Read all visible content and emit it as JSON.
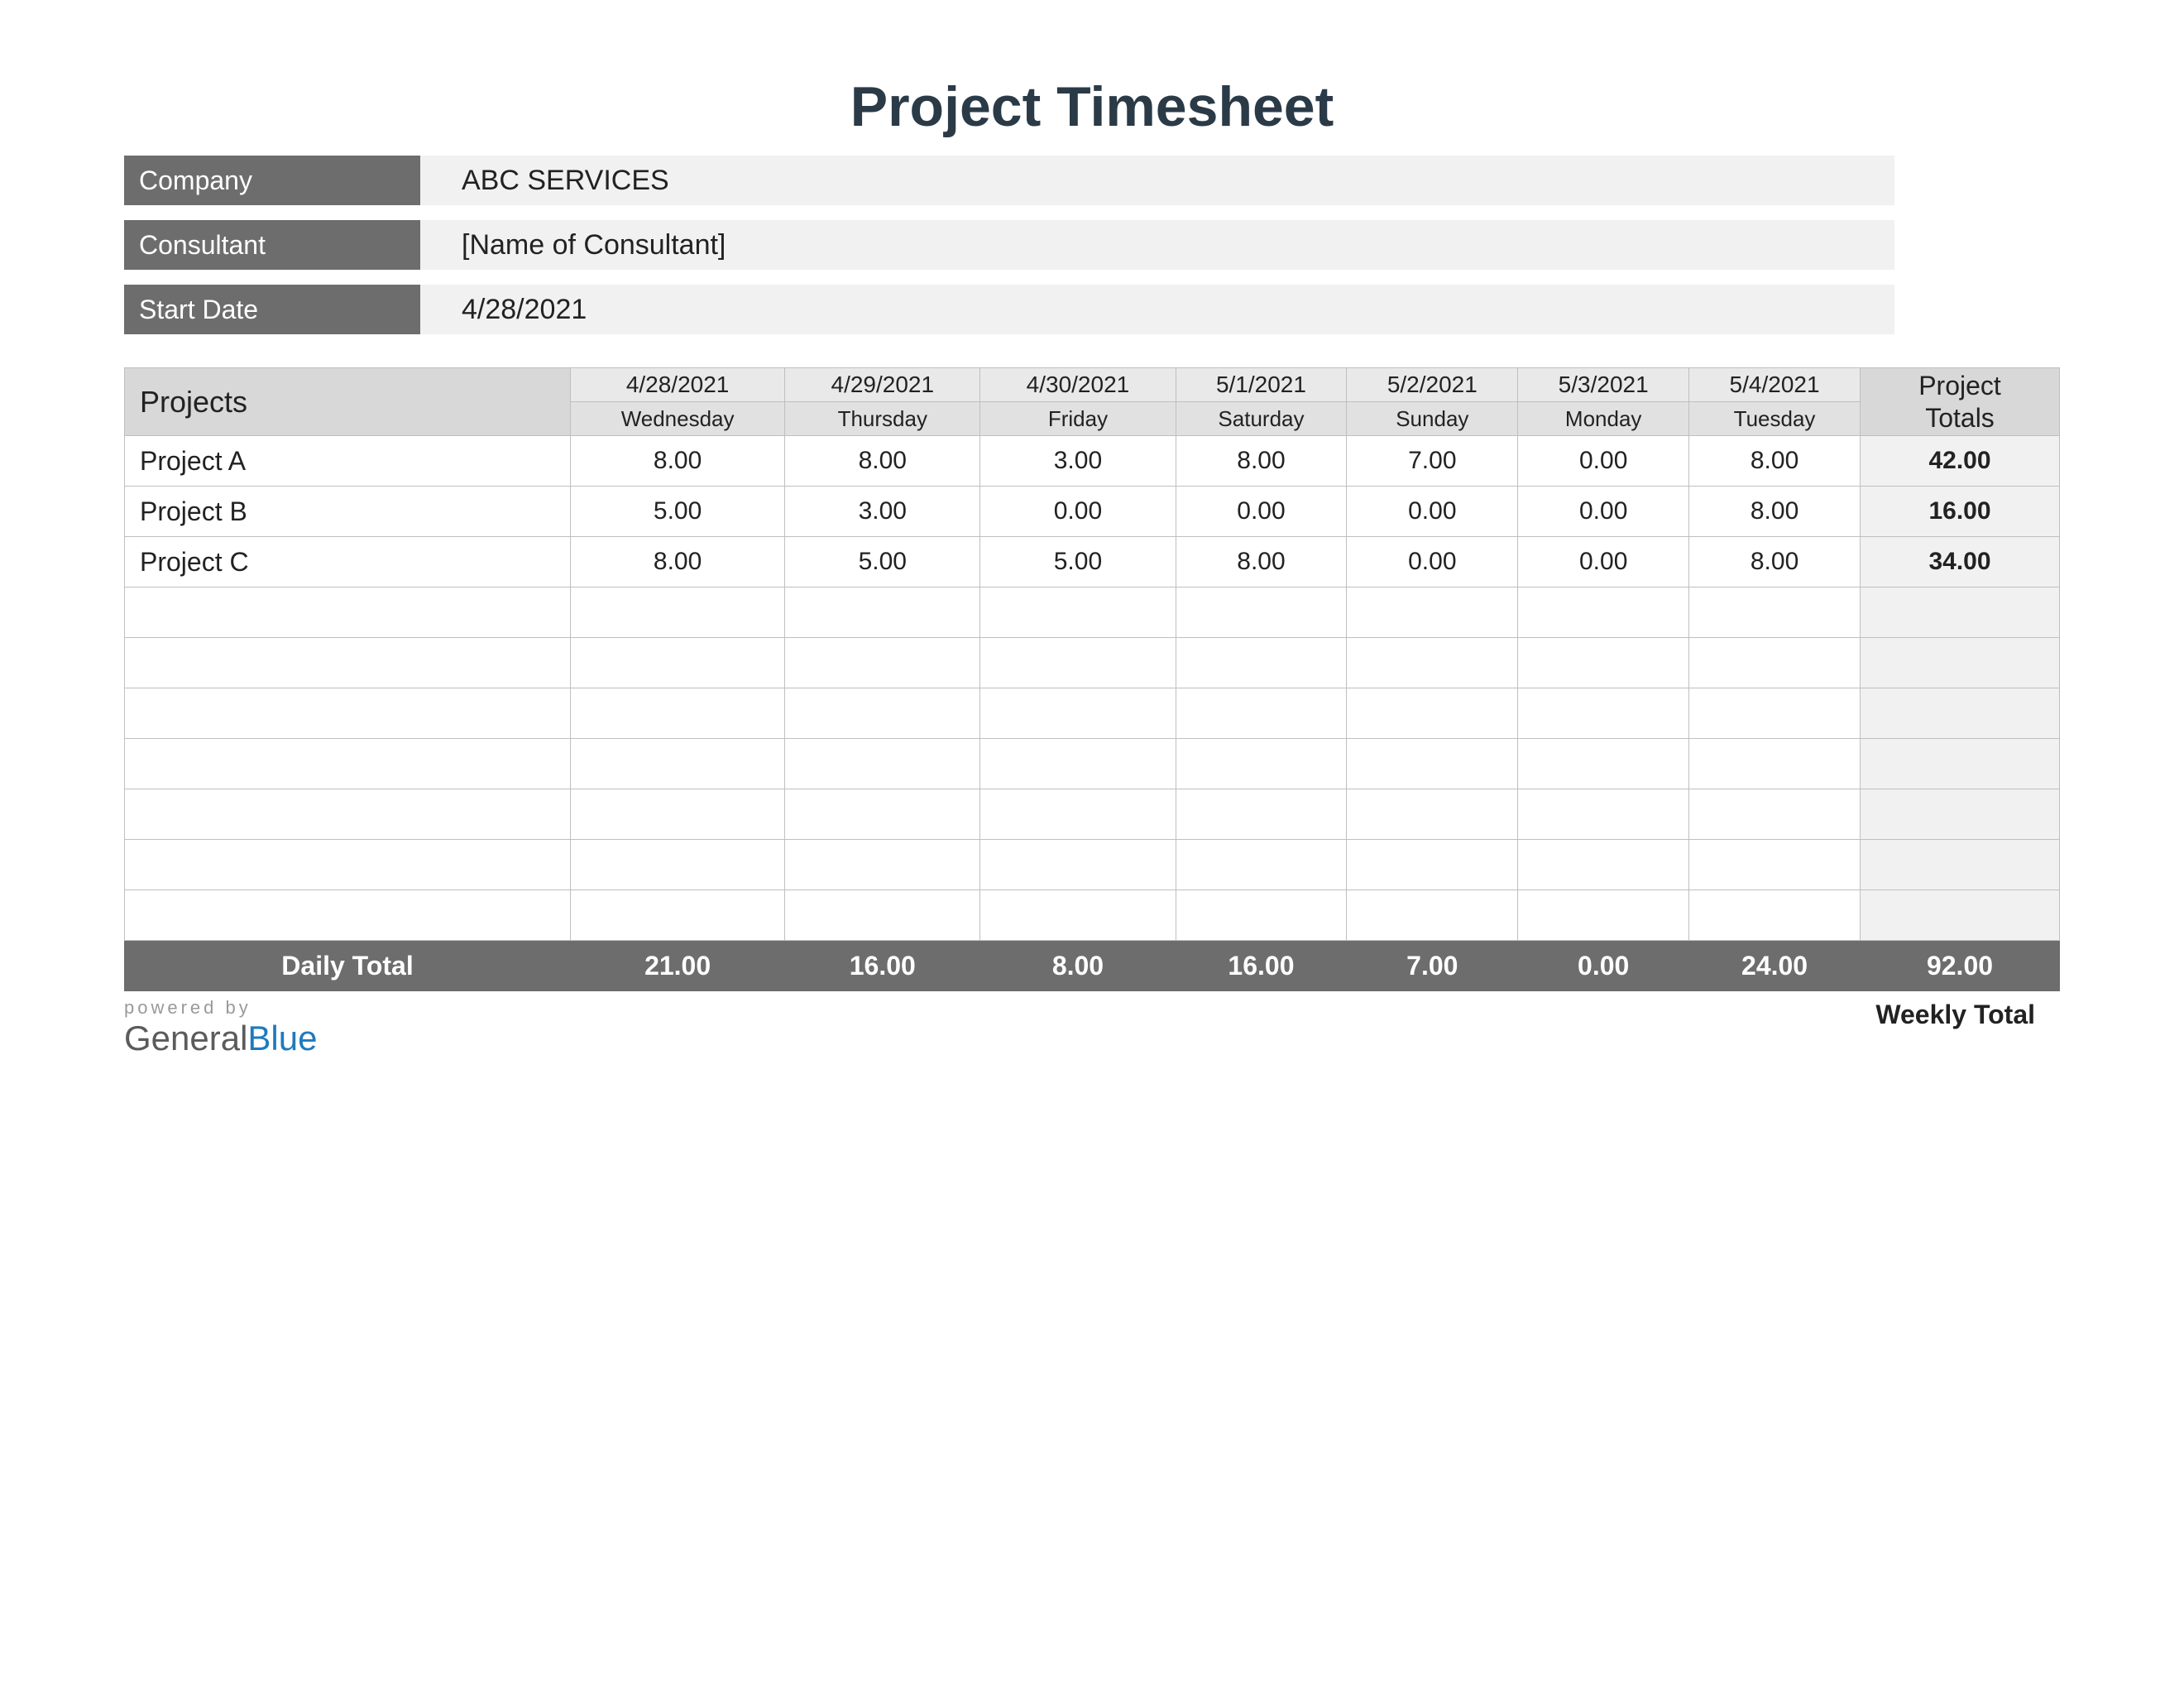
{
  "title": "Project Timesheet",
  "meta": {
    "company_label": "Company",
    "company_value": "ABC SERVICES",
    "consultant_label": "Consultant",
    "consultant_value": "[Name of Consultant]",
    "start_label": "Start Date",
    "start_value": "4/28/2021"
  },
  "headers": {
    "projects": "Projects",
    "totals_line1": "Project",
    "totals_line2": "Totals",
    "dates": [
      "4/28/2021",
      "4/29/2021",
      "4/30/2021",
      "5/1/2021",
      "5/2/2021",
      "5/3/2021",
      "5/4/2021"
    ],
    "days": [
      "Wednesday",
      "Thursday",
      "Friday",
      "Saturday",
      "Sunday",
      "Monday",
      "Tuesday"
    ]
  },
  "rows": [
    {
      "name": "Project A",
      "vals": [
        "8.00",
        "8.00",
        "3.00",
        "8.00",
        "7.00",
        "0.00",
        "8.00"
      ],
      "total": "42.00"
    },
    {
      "name": "Project B",
      "vals": [
        "5.00",
        "3.00",
        "0.00",
        "0.00",
        "0.00",
        "0.00",
        "8.00"
      ],
      "total": "16.00"
    },
    {
      "name": "Project C",
      "vals": [
        "8.00",
        "5.00",
        "5.00",
        "8.00",
        "0.00",
        "0.00",
        "8.00"
      ],
      "total": "34.00"
    }
  ],
  "empty_rows": 7,
  "daily": {
    "label": "Daily Total",
    "vals": [
      "21.00",
      "16.00",
      "8.00",
      "16.00",
      "7.00",
      "0.00",
      "24.00"
    ],
    "grand": "92.00"
  },
  "weekly_label": "Weekly Total",
  "footer": {
    "powered": "powered by",
    "brand1": "General",
    "brand2": "Blue"
  }
}
